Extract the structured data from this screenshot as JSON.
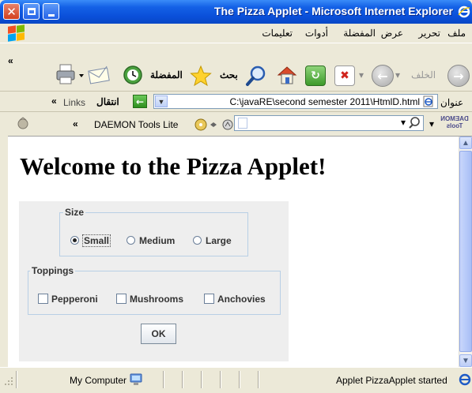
{
  "window": {
    "title": "The Pizza Applet - Microsoft Internet Explorer"
  },
  "menu": {
    "items": [
      "ملف",
      "تحرير",
      "عرض",
      "المفضلة",
      "أدوات",
      "تعليمات"
    ]
  },
  "toolbar": {
    "back_label": "الخلف",
    "search_label": "بحث",
    "favorites_label": "المفضلة",
    "more_chevron": "«"
  },
  "address": {
    "label": "عنوان",
    "value": "C:\\javaRE\\second semester 2011\\HtmlD.html",
    "go_label": "انتقال",
    "links_label": "Links",
    "links_chevron": "«"
  },
  "daemon": {
    "logo_text": "DAEMON Tools",
    "lite_label": "DAEMON Tools Lite",
    "chevron": "«"
  },
  "page": {
    "heading": "Welcome to the Pizza Applet!"
  },
  "applet": {
    "size": {
      "legend": "Size",
      "options": [
        "Small",
        "Medium",
        "Large"
      ],
      "selected": "Small"
    },
    "toppings": {
      "legend": "Toppings",
      "options": [
        "Pepperoni",
        "Mushrooms",
        "Anchovies"
      ]
    },
    "ok_label": "OK"
  },
  "status": {
    "text": "Applet PizzaApplet started",
    "zone": "My Computer"
  },
  "colors": {
    "titlebar": "#0A4FD9",
    "chrome": "#ECE9D8",
    "applet_bg": "#EEEEEE",
    "fieldset_border": "#B8CFE5"
  }
}
